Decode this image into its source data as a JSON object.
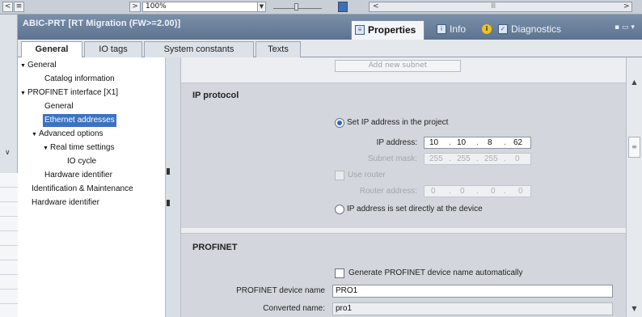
{
  "toolbar": {
    "zoom_value": "100%",
    "nav_left_icon": "arrow-left-icon",
    "nav_list_icon": "list-icon"
  },
  "window": {
    "title": "ABIC-PRT [RT Migration (FW>=2.00)]",
    "tabs": {
      "properties": "Properties",
      "info": "Info",
      "diagnostics": "Diagnostics"
    },
    "sub_tabs": [
      "General",
      "IO tags",
      "System constants",
      "Texts"
    ]
  },
  "tree": {
    "items": [
      {
        "label": "General",
        "caret": "▼"
      },
      {
        "label": "Catalog information",
        "caret": ""
      },
      {
        "label": "PROFINET interface [X1]",
        "caret": "▼"
      },
      {
        "label": "General",
        "caret": ""
      },
      {
        "label": "Ethernet addresses",
        "caret": ""
      },
      {
        "label": "Advanced options",
        "caret": "▼"
      },
      {
        "label": "Real time settings",
        "caret": "▼"
      },
      {
        "label": "IO cycle",
        "caret": ""
      },
      {
        "label": "Hardware identifier",
        "caret": ""
      },
      {
        "label": "Identification & Maintenance",
        "caret": ""
      },
      {
        "label": "Hardware identifier",
        "caret": ""
      }
    ]
  },
  "content": {
    "add_subnet_button": "Add new subnet",
    "ip_protocol": {
      "title": "IP protocol",
      "set_ip_option": "Set IP address in the project",
      "ip_label": "IP address:",
      "ip_octets": [
        "10",
        "10",
        "8",
        "62"
      ],
      "subnet_label": "Subnet mask:",
      "subnet_octets": [
        "255",
        "255",
        "255",
        "0"
      ],
      "use_router_label": "Use router",
      "router_label": "Router address:",
      "router_octets": [
        "0",
        "0",
        "0",
        "0"
      ],
      "direct_option": "IP address is set directly at the device"
    },
    "profinet": {
      "title": "PROFINET",
      "generate_name_label": "Generate PROFINET device name automatically",
      "device_name_label": "PROFINET device name",
      "device_name_value": "PRO1",
      "converted_name_label": "Converted name:",
      "converted_name_value": "pro1"
    }
  },
  "colors": {
    "title_bar": "#5d7390",
    "selection": "#3b72c4",
    "section_bg": "#d3d7dd"
  }
}
